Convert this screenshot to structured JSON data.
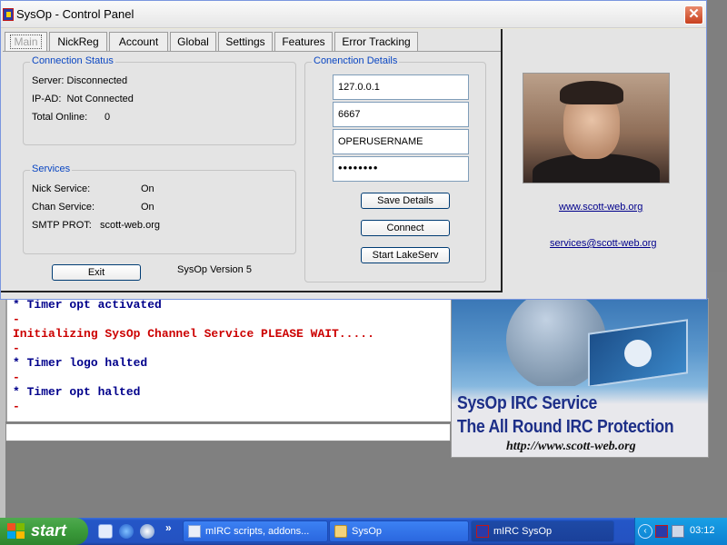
{
  "window": {
    "title": "SysOp - Control Panel",
    "close_label": "✕"
  },
  "tabs": [
    {
      "label": "Main",
      "active": true
    },
    {
      "label": "NickReg"
    },
    {
      "label": "Account"
    },
    {
      "label": "Global"
    },
    {
      "label": "Settings"
    },
    {
      "label": "Features"
    },
    {
      "label": "Error Tracking"
    }
  ],
  "connection_status": {
    "title": "Connection Status",
    "server": "Server: Disconnected",
    "ip": "IP-AD:  Not Connected",
    "total_online_label": "Total Online:",
    "total_online_value": "0"
  },
  "services": {
    "title": "Services",
    "nick_label": "Nick Service:",
    "nick_value": "On",
    "chan_label": "Chan Service:",
    "chan_value": "On",
    "smtp": "SMTP PROT:   scott-web.org"
  },
  "connection_details": {
    "title": "Conenction Details",
    "host": "127.0.0.1",
    "port": "6667",
    "username": "OPERUSERNAME",
    "password": "••••••••",
    "save_label": "Save Details",
    "connect_label": "Connect",
    "start_label": "Start LakeServ"
  },
  "footer": {
    "exit_label": "Exit",
    "version": "SysOp Version 5"
  },
  "profile": {
    "website": "www.scott-web.org",
    "email": "services@scott-web.org"
  },
  "mirc_log": [
    {
      "text": "* Timer opt activated",
      "color": "blue"
    },
    {
      "text": "-",
      "color": "red"
    },
    {
      "text": "Initializing SysOp Channel Service PLEASE WAIT.....",
      "color": "red"
    },
    {
      "text": "-",
      "color": "red"
    },
    {
      "text": "* Timer logo halted",
      "color": "blue"
    },
    {
      "text": "-",
      "color": "red"
    },
    {
      "text": "* Timer opt halted",
      "color": "blue"
    },
    {
      "text": "-",
      "color": "red"
    }
  ],
  "banner": {
    "line1": "SysOp IRC Service",
    "line2": "The All Round IRC Protection",
    "url": "http://www.scott-web.org"
  },
  "taskbar": {
    "start_label": "start",
    "more_label": "»",
    "tasks": [
      {
        "label": "mIRC scripts, addons..."
      },
      {
        "label": "SysOp"
      },
      {
        "label": "mIRC SysOp",
        "active": true
      }
    ],
    "tray_arrow": "‹",
    "clock": "03:12"
  },
  "colors": {
    "accent": "#0a46c2",
    "log_red": "#cc0000",
    "log_blue": "#00008b",
    "taskbar": "#2452c1",
    "start_green": "#3a9a3a"
  }
}
